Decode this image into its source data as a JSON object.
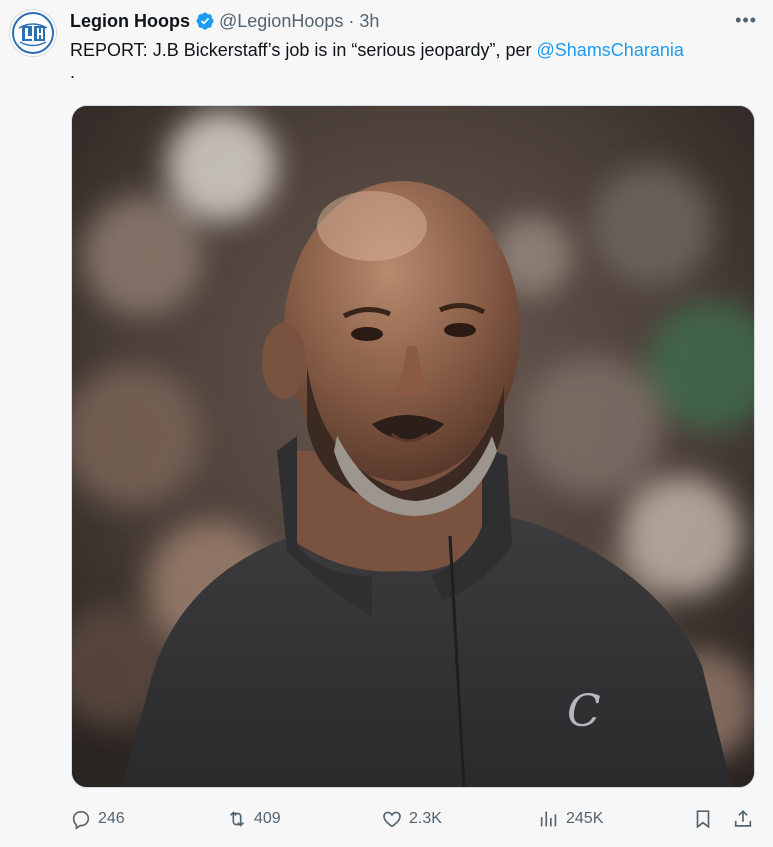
{
  "tweet": {
    "author_name": "Legion Hoops",
    "handle": "@LegionHoops",
    "separator": "·",
    "time": "3h",
    "more_label": "•••",
    "text_before_mention": "REPORT: J.B Bickerstaff’s job is in “serious jeopardy”, per ",
    "mention": "@ShamsCharania",
    "text_after_mention": "."
  },
  "avatar": {
    "logo_letters": "LH"
  },
  "actions": {
    "reply_count": "246",
    "retweet_count": "409",
    "like_count": "2.3K",
    "views_count": "245K"
  },
  "icons": {
    "verified": "verified-badge-icon",
    "reply": "reply-icon",
    "retweet": "retweet-icon",
    "like": "heart-icon",
    "views": "views-chart-icon",
    "bookmark": "bookmark-icon",
    "share": "share-icon"
  },
  "colors": {
    "link": "#1d9bf0",
    "secondary_text": "#536471",
    "primary_text": "#0f1419",
    "background": "#f7f7f7"
  }
}
